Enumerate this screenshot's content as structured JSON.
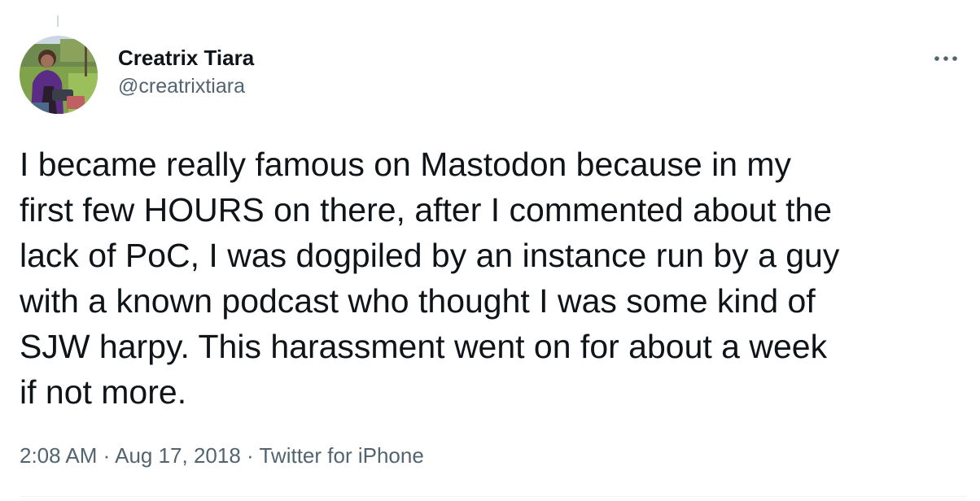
{
  "tweet": {
    "author": {
      "display_name": "Creatrix Tiara",
      "handle": "@creatrixtiara",
      "avatar_icon": "profile-photo"
    },
    "more_icon": "more-horizontal-icon",
    "text_lines": [
      "I became really famous on Mastodon because in my",
      "first few HOURS on there, after I commented about the",
      "lack of PoC, I was dogpiled by an instance run by a guy",
      "with a known podcast who thought I was some kind of",
      "SJW harpy. This harassment went on for about a week",
      "if not more."
    ],
    "time": "2:08 AM",
    "separator": "·",
    "date": "Aug 17, 2018",
    "source": "Twitter for iPhone"
  },
  "colors": {
    "text_primary": "#0f1419",
    "text_secondary": "#536471",
    "thread_line": "#cfd9de"
  }
}
